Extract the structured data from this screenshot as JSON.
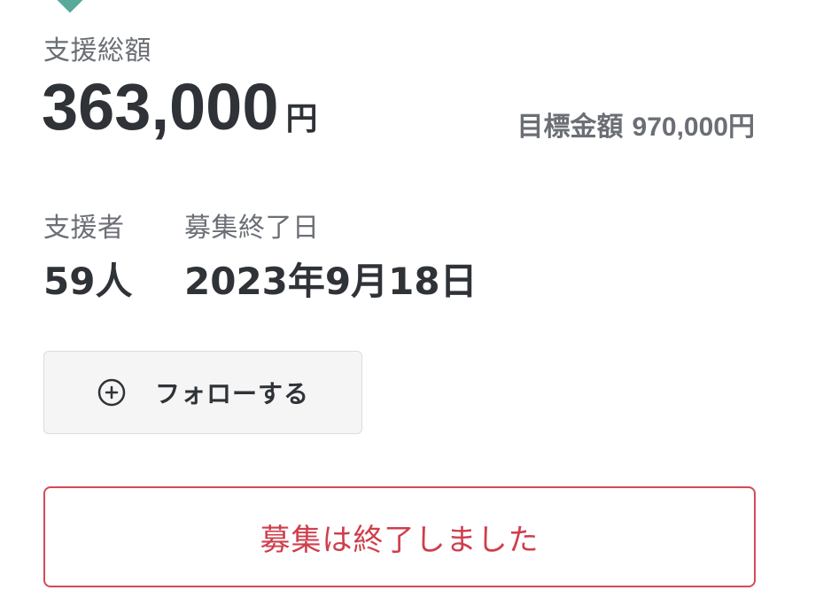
{
  "funding": {
    "total_label": "支援総額",
    "total_amount": "363,000",
    "total_unit": "円",
    "goal_label": "目標金額",
    "goal_value": "970,000円"
  },
  "stats": {
    "supporters_label": "支援者",
    "supporters_value": "59人",
    "end_date_label": "募集終了日",
    "end_date_value": "2023年9月18日"
  },
  "follow": {
    "label": "フォローする",
    "icon": "plus-circle-icon"
  },
  "status": {
    "ended_text": "募集は終了しました"
  },
  "colors": {
    "accent": "#5aa99a",
    "ended": "#cf3e4c",
    "text": "#2f3338",
    "muted": "#6b6f75"
  }
}
